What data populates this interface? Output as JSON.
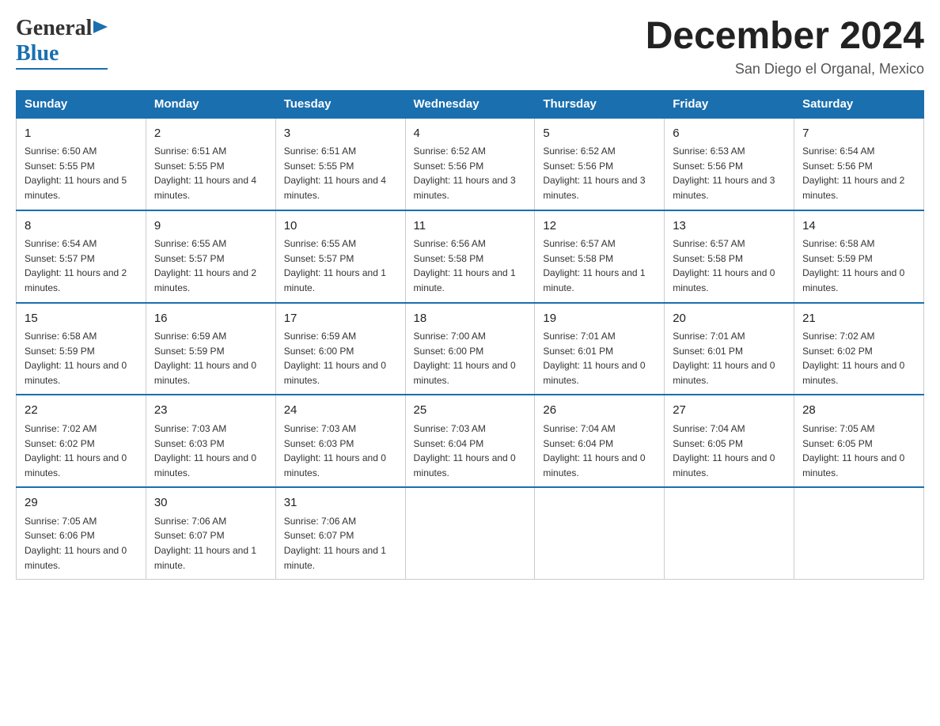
{
  "header": {
    "logo_text_black": "General",
    "logo_text_blue": "Blue",
    "month_title": "December 2024",
    "location": "San Diego el Organal, Mexico"
  },
  "days_of_week": [
    "Sunday",
    "Monday",
    "Tuesday",
    "Wednesday",
    "Thursday",
    "Friday",
    "Saturday"
  ],
  "weeks": [
    [
      {
        "day": "1",
        "sunrise": "6:50 AM",
        "sunset": "5:55 PM",
        "daylight": "11 hours and 5 minutes."
      },
      {
        "day": "2",
        "sunrise": "6:51 AM",
        "sunset": "5:55 PM",
        "daylight": "11 hours and 4 minutes."
      },
      {
        "day": "3",
        "sunrise": "6:51 AM",
        "sunset": "5:55 PM",
        "daylight": "11 hours and 4 minutes."
      },
      {
        "day": "4",
        "sunrise": "6:52 AM",
        "sunset": "5:56 PM",
        "daylight": "11 hours and 3 minutes."
      },
      {
        "day": "5",
        "sunrise": "6:52 AM",
        "sunset": "5:56 PM",
        "daylight": "11 hours and 3 minutes."
      },
      {
        "day": "6",
        "sunrise": "6:53 AM",
        "sunset": "5:56 PM",
        "daylight": "11 hours and 3 minutes."
      },
      {
        "day": "7",
        "sunrise": "6:54 AM",
        "sunset": "5:56 PM",
        "daylight": "11 hours and 2 minutes."
      }
    ],
    [
      {
        "day": "8",
        "sunrise": "6:54 AM",
        "sunset": "5:57 PM",
        "daylight": "11 hours and 2 minutes."
      },
      {
        "day": "9",
        "sunrise": "6:55 AM",
        "sunset": "5:57 PM",
        "daylight": "11 hours and 2 minutes."
      },
      {
        "day": "10",
        "sunrise": "6:55 AM",
        "sunset": "5:57 PM",
        "daylight": "11 hours and 1 minute."
      },
      {
        "day": "11",
        "sunrise": "6:56 AM",
        "sunset": "5:58 PM",
        "daylight": "11 hours and 1 minute."
      },
      {
        "day": "12",
        "sunrise": "6:57 AM",
        "sunset": "5:58 PM",
        "daylight": "11 hours and 1 minute."
      },
      {
        "day": "13",
        "sunrise": "6:57 AM",
        "sunset": "5:58 PM",
        "daylight": "11 hours and 0 minutes."
      },
      {
        "day": "14",
        "sunrise": "6:58 AM",
        "sunset": "5:59 PM",
        "daylight": "11 hours and 0 minutes."
      }
    ],
    [
      {
        "day": "15",
        "sunrise": "6:58 AM",
        "sunset": "5:59 PM",
        "daylight": "11 hours and 0 minutes."
      },
      {
        "day": "16",
        "sunrise": "6:59 AM",
        "sunset": "5:59 PM",
        "daylight": "11 hours and 0 minutes."
      },
      {
        "day": "17",
        "sunrise": "6:59 AM",
        "sunset": "6:00 PM",
        "daylight": "11 hours and 0 minutes."
      },
      {
        "day": "18",
        "sunrise": "7:00 AM",
        "sunset": "6:00 PM",
        "daylight": "11 hours and 0 minutes."
      },
      {
        "day": "19",
        "sunrise": "7:01 AM",
        "sunset": "6:01 PM",
        "daylight": "11 hours and 0 minutes."
      },
      {
        "day": "20",
        "sunrise": "7:01 AM",
        "sunset": "6:01 PM",
        "daylight": "11 hours and 0 minutes."
      },
      {
        "day": "21",
        "sunrise": "7:02 AM",
        "sunset": "6:02 PM",
        "daylight": "11 hours and 0 minutes."
      }
    ],
    [
      {
        "day": "22",
        "sunrise": "7:02 AM",
        "sunset": "6:02 PM",
        "daylight": "11 hours and 0 minutes."
      },
      {
        "day": "23",
        "sunrise": "7:03 AM",
        "sunset": "6:03 PM",
        "daylight": "11 hours and 0 minutes."
      },
      {
        "day": "24",
        "sunrise": "7:03 AM",
        "sunset": "6:03 PM",
        "daylight": "11 hours and 0 minutes."
      },
      {
        "day": "25",
        "sunrise": "7:03 AM",
        "sunset": "6:04 PM",
        "daylight": "11 hours and 0 minutes."
      },
      {
        "day": "26",
        "sunrise": "7:04 AM",
        "sunset": "6:04 PM",
        "daylight": "11 hours and 0 minutes."
      },
      {
        "day": "27",
        "sunrise": "7:04 AM",
        "sunset": "6:05 PM",
        "daylight": "11 hours and 0 minutes."
      },
      {
        "day": "28",
        "sunrise": "7:05 AM",
        "sunset": "6:05 PM",
        "daylight": "11 hours and 0 minutes."
      }
    ],
    [
      {
        "day": "29",
        "sunrise": "7:05 AM",
        "sunset": "6:06 PM",
        "daylight": "11 hours and 0 minutes."
      },
      {
        "day": "30",
        "sunrise": "7:06 AM",
        "sunset": "6:07 PM",
        "daylight": "11 hours and 1 minute."
      },
      {
        "day": "31",
        "sunrise": "7:06 AM",
        "sunset": "6:07 PM",
        "daylight": "11 hours and 1 minute."
      },
      null,
      null,
      null,
      null
    ]
  ],
  "labels": {
    "sunrise": "Sunrise:",
    "sunset": "Sunset:",
    "daylight": "Daylight:"
  }
}
